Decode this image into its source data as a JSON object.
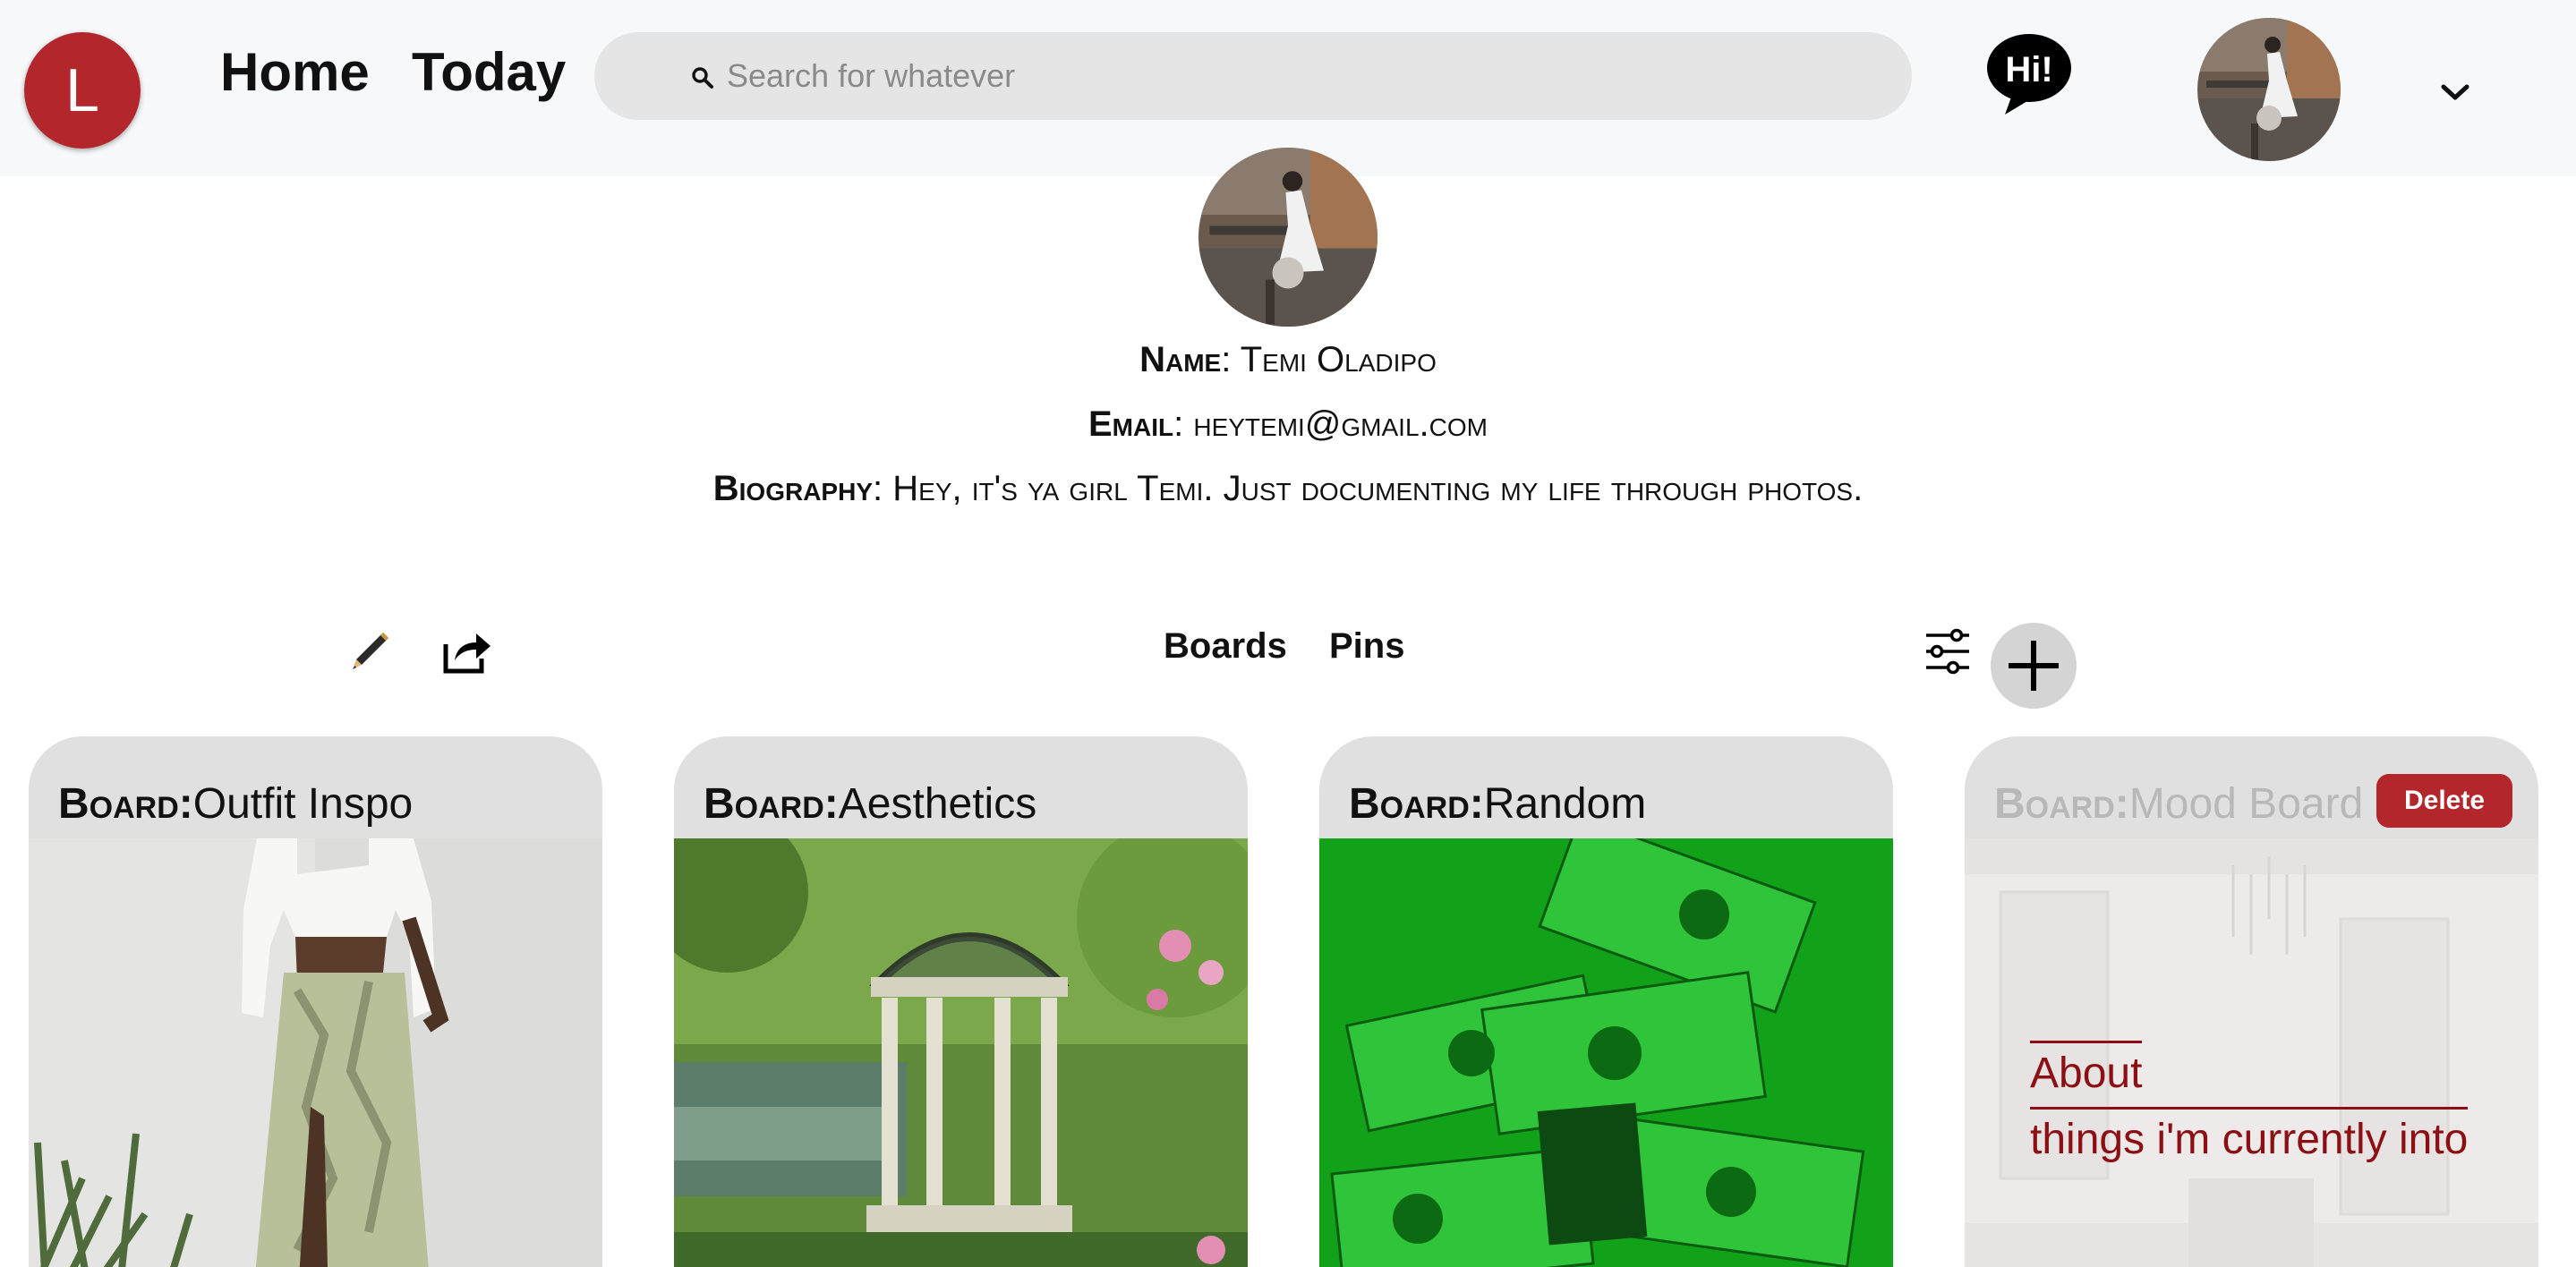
{
  "header": {
    "logo_letter": "L",
    "nav": {
      "home": "Home",
      "today": "Today"
    },
    "search": {
      "placeholder": "Search for whatever",
      "icon": "search-icon"
    },
    "chat_icon_text": "Hi!"
  },
  "profile": {
    "name_label": "Name",
    "name_value": "Temi Oladipo",
    "email_label": "Email",
    "email_value": "heytemi@gmail.com",
    "bio_label": "Biography",
    "bio_value": "Hey, it's ya girl Temi. Just documenting my life through photos."
  },
  "toolbar": {
    "tabs": [
      "Boards",
      "Pins"
    ],
    "icons": [
      "pencil-icon",
      "share-icon",
      "filter-icon",
      "plus-icon"
    ]
  },
  "boards": [
    {
      "label": "Board:",
      "name": "Outfit Inspo"
    },
    {
      "label": "Board:",
      "name": "Aesthetics"
    },
    {
      "label": "Board:",
      "name": "Random"
    },
    {
      "label": "Board:",
      "name": "Mood Board",
      "delete_label": "Delete",
      "about_line1": "About",
      "about_line2": "things i'm currently into"
    }
  ],
  "colors": {
    "brand": "#b3262b",
    "topbar": "#f7f8f9",
    "search_bg": "#e5e5e5",
    "board_header": "#e0e0e0",
    "about_text": "#8c0f14"
  }
}
